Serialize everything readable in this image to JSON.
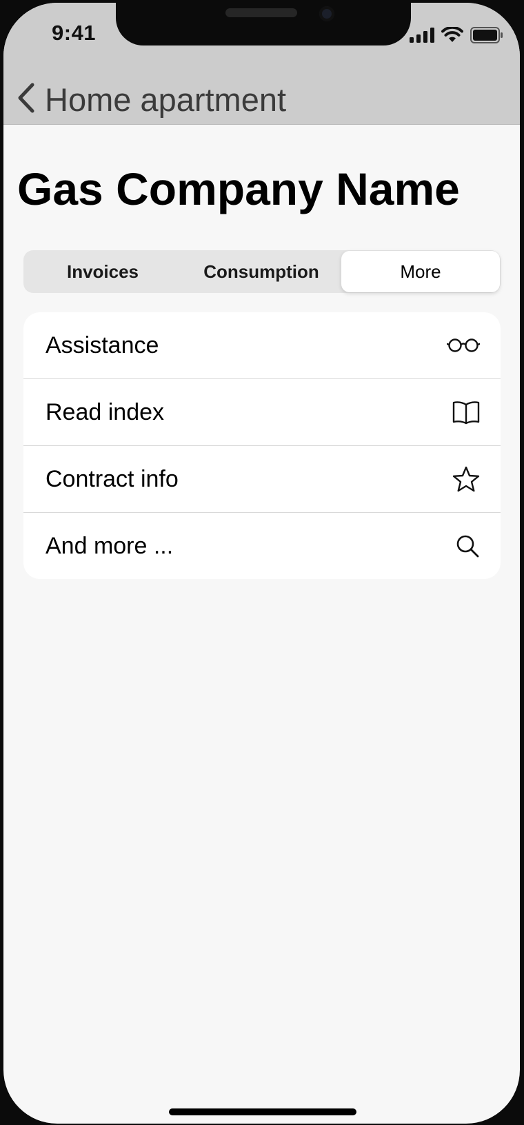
{
  "status_bar": {
    "time": "9:41",
    "icons": [
      "signal-icon",
      "wifi-icon",
      "battery-icon"
    ]
  },
  "nav": {
    "back_label": "Home apartment",
    "back_icon": "chevron-left-icon"
  },
  "page": {
    "title": "Gas Company Name"
  },
  "tabs": [
    {
      "label": "Invoices",
      "active": false
    },
    {
      "label": "Consumption",
      "active": false
    },
    {
      "label": "More",
      "active": true
    }
  ],
  "list": {
    "items": [
      {
        "label": "Assistance",
        "icon": "eyeglasses-icon"
      },
      {
        "label": "Read index",
        "icon": "book-icon"
      },
      {
        "label": "Contract info",
        "icon": "star-icon"
      },
      {
        "label": "And more ...",
        "icon": "search-icon"
      }
    ]
  },
  "colors": {
    "header_bg": "#cccccc",
    "page_bg": "#f7f7f7",
    "card_bg": "#ffffff",
    "segment_bg": "#e5e5e5"
  }
}
